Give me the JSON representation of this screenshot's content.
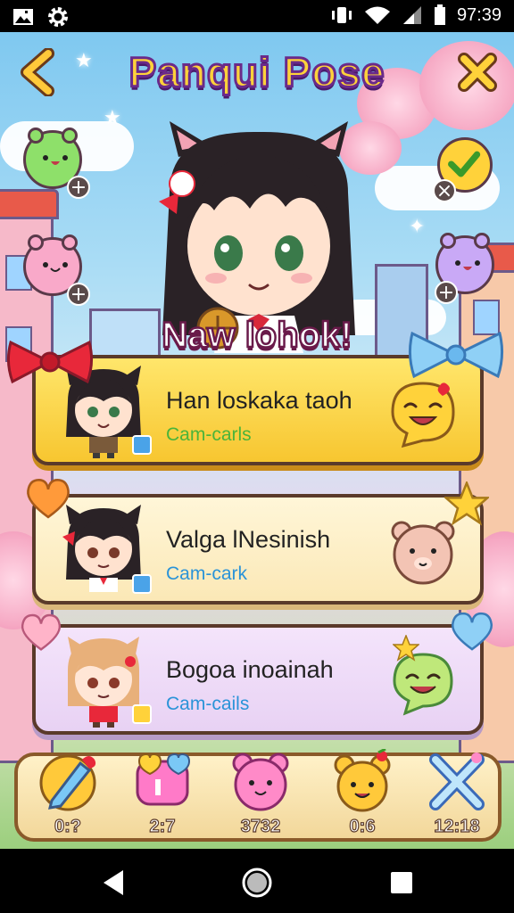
{
  "status_bar": {
    "time": "97:39",
    "icons": [
      "gallery-icon",
      "settings-gear-icon",
      "vibrate-icon",
      "wifi-icon",
      "signal-icon",
      "battery-icon"
    ]
  },
  "header": {
    "title": "Panqui Pose",
    "back_icon": "chevron-left-icon",
    "close_icon": "close-x-icon"
  },
  "hero": {
    "banner": "Naw lohok!"
  },
  "cards": [
    {
      "name": "Han loskaka taoh",
      "subtitle": "Cam-carls",
      "emote": "laughing-face-emote",
      "bow": "red-bow"
    },
    {
      "name": "Valga lNesinish",
      "subtitle": "Cam-cark",
      "emote": "bear-face-emote",
      "bow": "orange-heart"
    },
    {
      "name": "Bogoa inoainah",
      "subtitle": "Cam-cails",
      "emote": "smile-bubble-emote",
      "bow": "pink-heart"
    }
  ],
  "tray": [
    {
      "icon": "pencil-coin-icon",
      "count": "0:?"
    },
    {
      "icon": "hearts-chat-icon",
      "count": "2:7"
    },
    {
      "icon": "pink-bear-icon",
      "count": "3732"
    },
    {
      "icon": "yellow-bear-icon",
      "count": "0:6"
    },
    {
      "icon": "crossed-swords-icon",
      "count": "12:18"
    }
  ],
  "colors": {
    "title_fill": "#ffd23a",
    "title_stroke": "#6a2a8a",
    "card_highlight": "#f7c630",
    "subtitle_green": "#4ab43a",
    "subtitle_blue": "#2a93d8"
  }
}
